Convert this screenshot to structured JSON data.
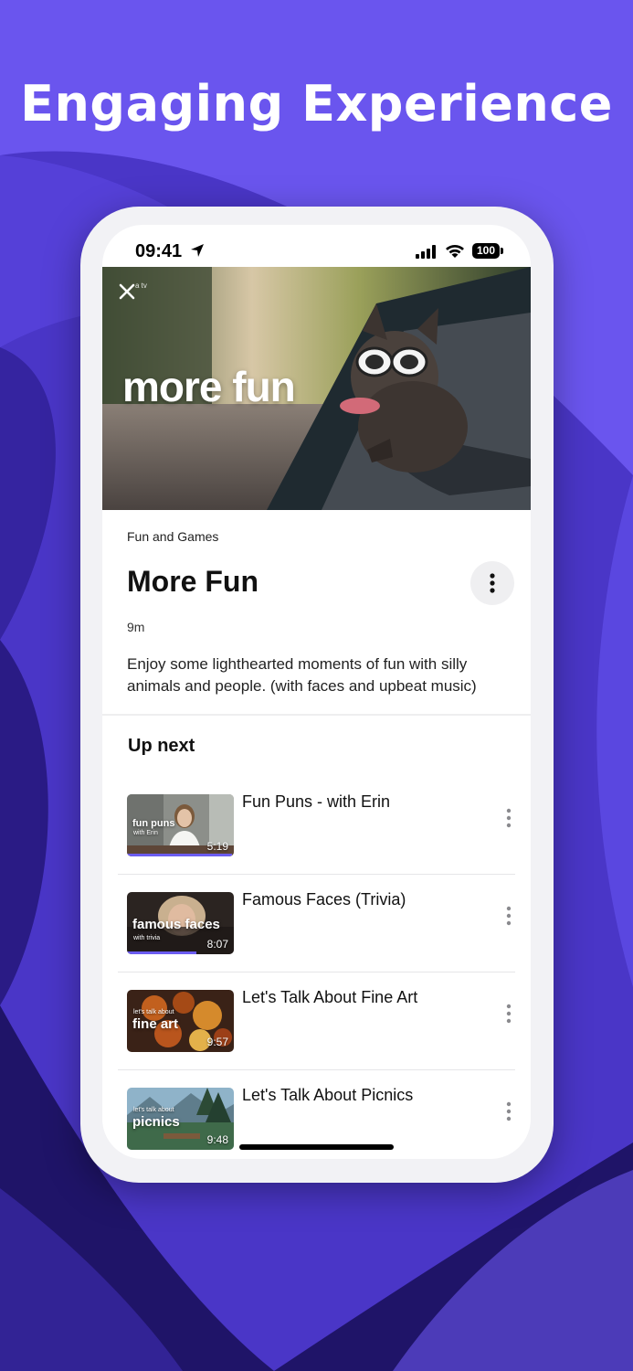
{
  "promo": {
    "headline": "Engaging Experience"
  },
  "status_bar": {
    "time": "09:41",
    "battery": "100"
  },
  "hero": {
    "overlay_title": "more fun",
    "brand_mark": "a tv"
  },
  "video": {
    "category": "Fun and Games",
    "title": "More Fun",
    "duration": "9m",
    "description": "Enjoy some lighthearted moments of fun with silly animals and people. (with faces and upbeat music)"
  },
  "up_next": {
    "heading": "Up next",
    "items": [
      {
        "title": "Fun Puns - with Erin",
        "thumb_title": "fun puns",
        "thumb_subtitle": "with Erin",
        "duration": "5:19",
        "progress": 0.98
      },
      {
        "title": "Famous Faces (Trivia)",
        "thumb_title": "famous faces",
        "thumb_subtitle": "with trivia",
        "duration": "8:07",
        "progress": 0.65
      },
      {
        "title": "Let's Talk About Fine Art",
        "thumb_title": "fine art",
        "thumb_subtitle": "let's talk about",
        "duration": "9:57",
        "progress": 0
      },
      {
        "title": "Let's Talk About Picnics",
        "thumb_title": "picnics",
        "thumb_subtitle": "let's talk about",
        "duration": "9:48",
        "progress": 0
      }
    ]
  },
  "icons": {
    "close": "close-icon",
    "more": "more-vertical-icon",
    "location": "location-arrow-icon",
    "signal": "cellular-signal-icon",
    "wifi": "wifi-icon"
  },
  "colors": {
    "background": "#3a2aa8",
    "accent": "#6b5cf0",
    "text": "#111111"
  }
}
